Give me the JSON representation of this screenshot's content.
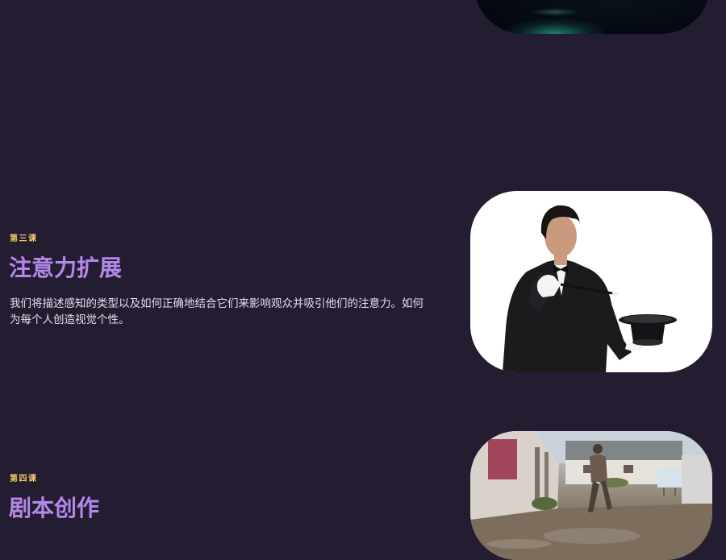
{
  "lessons": [
    {
      "tag": "第三课",
      "title": "注意力扩展",
      "description": "我们将描述感知的类型以及如何正确地结合它们来影响观众并吸引他们的注意力。如何为每个人创造视觉个性。",
      "image": "magician-with-top-hat-image"
    },
    {
      "tag": "第四课",
      "title": "剧本创作",
      "image": "person-walking-muddy-street-image"
    }
  ],
  "colors": {
    "background": "#241d31",
    "tag": "#f2c96a",
    "title": "#b388e8",
    "text": "#e4e0ec"
  }
}
